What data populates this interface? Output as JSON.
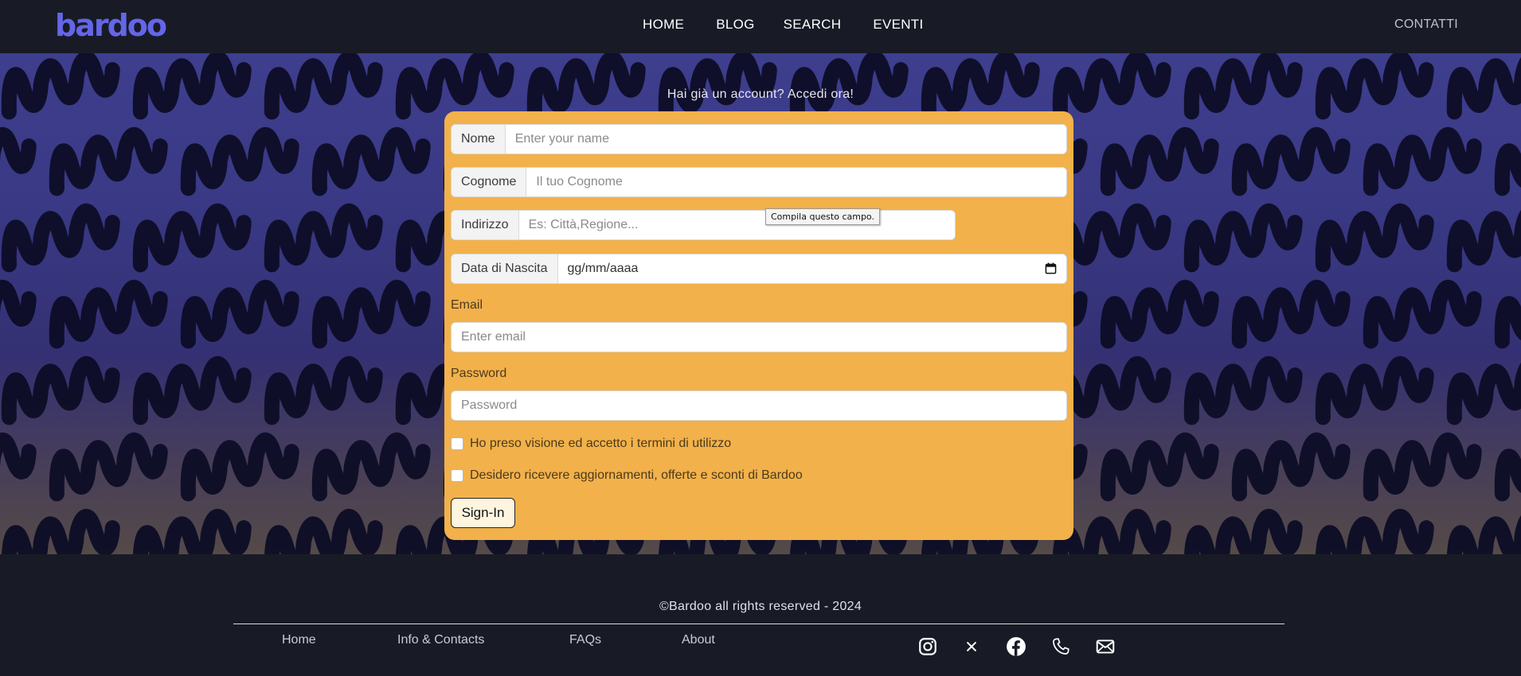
{
  "brand": {
    "logo_text": "bardoo",
    "color": "#6466e8"
  },
  "nav": {
    "links": [
      {
        "label": "HOME"
      },
      {
        "label": "BLOG"
      },
      {
        "label": "SEARCH"
      },
      {
        "label": "EVENTI"
      }
    ],
    "contact_label": "CONTATTI"
  },
  "hero": {
    "login_prompt": "Hai già un account? Accedi ora!"
  },
  "form": {
    "nome": {
      "label": "Nome",
      "placeholder": "Enter your name"
    },
    "cognome": {
      "label": "Cognome",
      "placeholder": "Il tuo Cognome"
    },
    "indirizzo": {
      "label": "Indirizzo",
      "placeholder": "Es: Città,Regione..."
    },
    "nascita": {
      "label": "Data di Nascita",
      "value": "gg/mm/aaaa"
    },
    "email": {
      "label": "Email",
      "placeholder": "Enter email"
    },
    "password": {
      "label": "Password",
      "placeholder": "Password"
    },
    "terms_label": "Ho preso visione ed accetto i termini di utilizzo",
    "newsletter_label": "Desidero ricevere aggiornamenti, offerte e sconti di Bardoo",
    "submit_label": "Sign-In",
    "card_color": "#f2b14a"
  },
  "tooltip": {
    "text": "Compila questo campo."
  },
  "footer": {
    "copyright": "©Bardoo all rights reserved - 2024",
    "links": [
      {
        "label": "Home"
      },
      {
        "label": "Info & Contacts"
      },
      {
        "label": "FAQs"
      },
      {
        "label": "About"
      }
    ],
    "social_icons": [
      "instagram-icon",
      "x-icon",
      "facebook-icon",
      "phone-icon",
      "mail-icon"
    ]
  }
}
